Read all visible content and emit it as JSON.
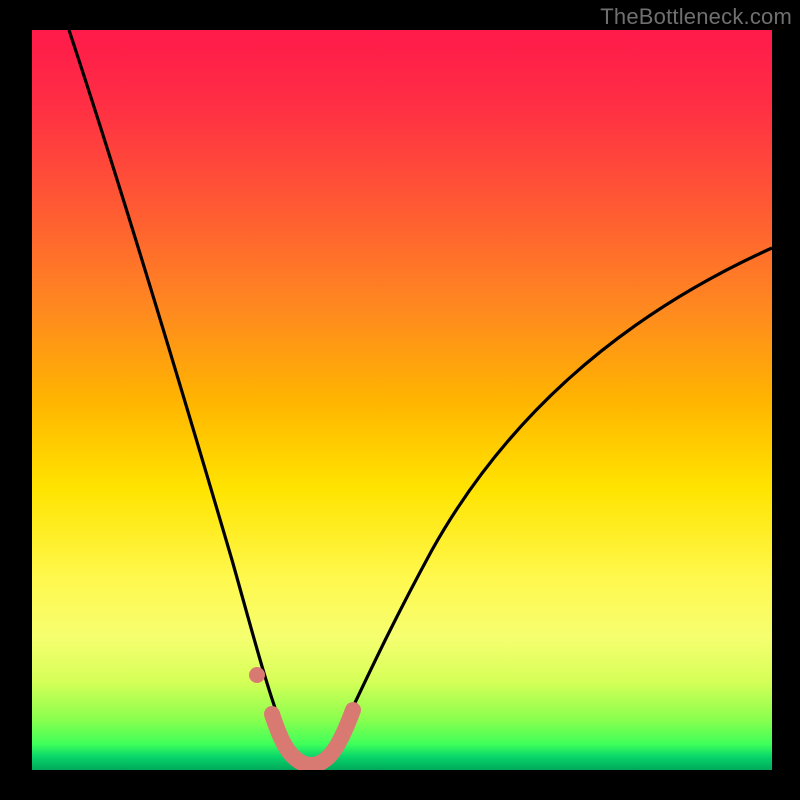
{
  "watermark": "TheBottleneck.com",
  "colors": {
    "background": "#000000",
    "curve": "#000000",
    "highlight": "#d97a72"
  },
  "chart_data": {
    "type": "line",
    "title": "",
    "xlabel": "",
    "ylabel": "",
    "xlim": [
      0,
      100
    ],
    "ylim": [
      0,
      100
    ],
    "grid": false,
    "legend": null,
    "annotations": [
      "TheBottleneck.com"
    ],
    "series": [
      {
        "name": "bottleneck-curve",
        "x": [
          5,
          10,
          15,
          20,
          25,
          28,
          30,
          32,
          34,
          36,
          38,
          40,
          45,
          50,
          55,
          60,
          65,
          70,
          75,
          80,
          85,
          90,
          95,
          100
        ],
        "y": [
          100,
          87,
          73,
          59,
          40,
          26,
          17,
          9,
          3,
          1,
          1,
          3,
          11,
          21,
          31,
          39,
          46,
          52,
          57,
          61,
          64,
          67,
          69,
          71
        ]
      }
    ],
    "highlight_range_x": [
      30,
      40
    ],
    "highlight_marker_x": 28.5
  }
}
